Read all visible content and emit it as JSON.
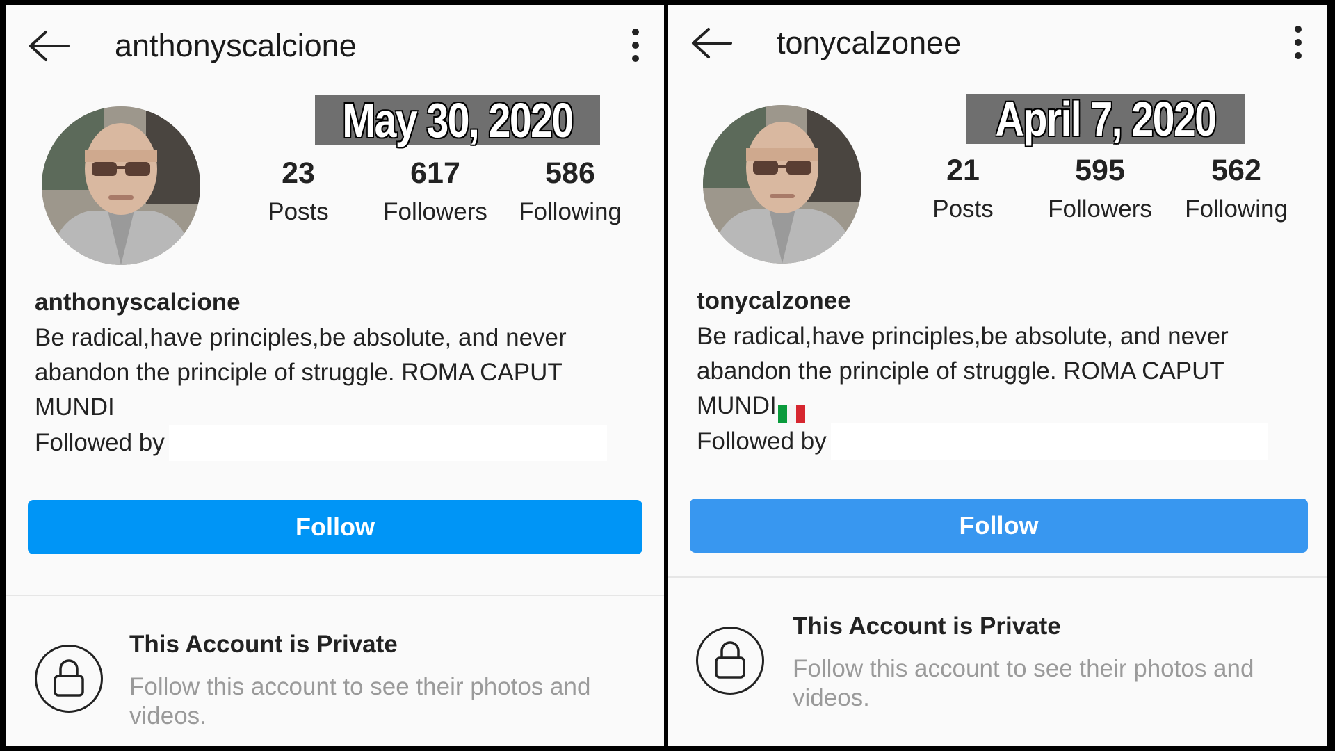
{
  "left": {
    "username": "anthonyscalcione",
    "date_label": "May 30, 2020",
    "stats": [
      {
        "value": "23",
        "label": "Posts"
      },
      {
        "value": "617",
        "label": "Followers"
      },
      {
        "value": "586",
        "label": "Following"
      }
    ],
    "bio_name": "anthonyscalcione",
    "bio_line1": "Be radical,have principles,be absolute, and never",
    "bio_line2": "abandon the principle of struggle. ROMA CAPUT",
    "bio_line3": "MUNDI",
    "followed_by": "Followed by",
    "follow_label": "Follow",
    "follow_color": "#0095f6",
    "private_title": "This Account is Private",
    "private_sub": "Follow this account to see their photos and videos."
  },
  "right": {
    "username": "tonycalzonee",
    "date_label": "April 7, 2020",
    "stats": [
      {
        "value": "21",
        "label": "Posts"
      },
      {
        "value": "595",
        "label": "Followers"
      },
      {
        "value": "562",
        "label": "Following"
      }
    ],
    "bio_name": "tonycalzonee",
    "bio_line1": "Be radical,have principles,be absolute, and never",
    "bio_line2": "abandon the principle of struggle. ROMA CAPUT",
    "bio_line3": "MUNDI",
    "bio_flag": "italy-flag-icon",
    "followed_by": "Followed by",
    "follow_label": "Follow",
    "follow_color": "#3897f0",
    "private_title": "This Account is Private",
    "private_sub": "Follow this account to see their photos and videos."
  }
}
